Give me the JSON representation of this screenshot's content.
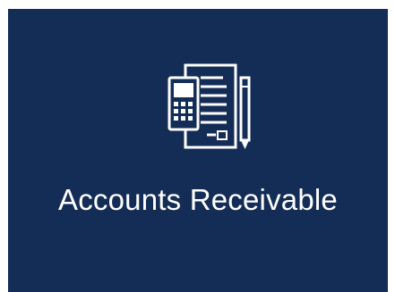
{
  "tile": {
    "label": "Accounts Receivable",
    "icon": "invoice-calculator-pen-icon",
    "background_color": "#142d57",
    "text_color": "#ffffff"
  }
}
